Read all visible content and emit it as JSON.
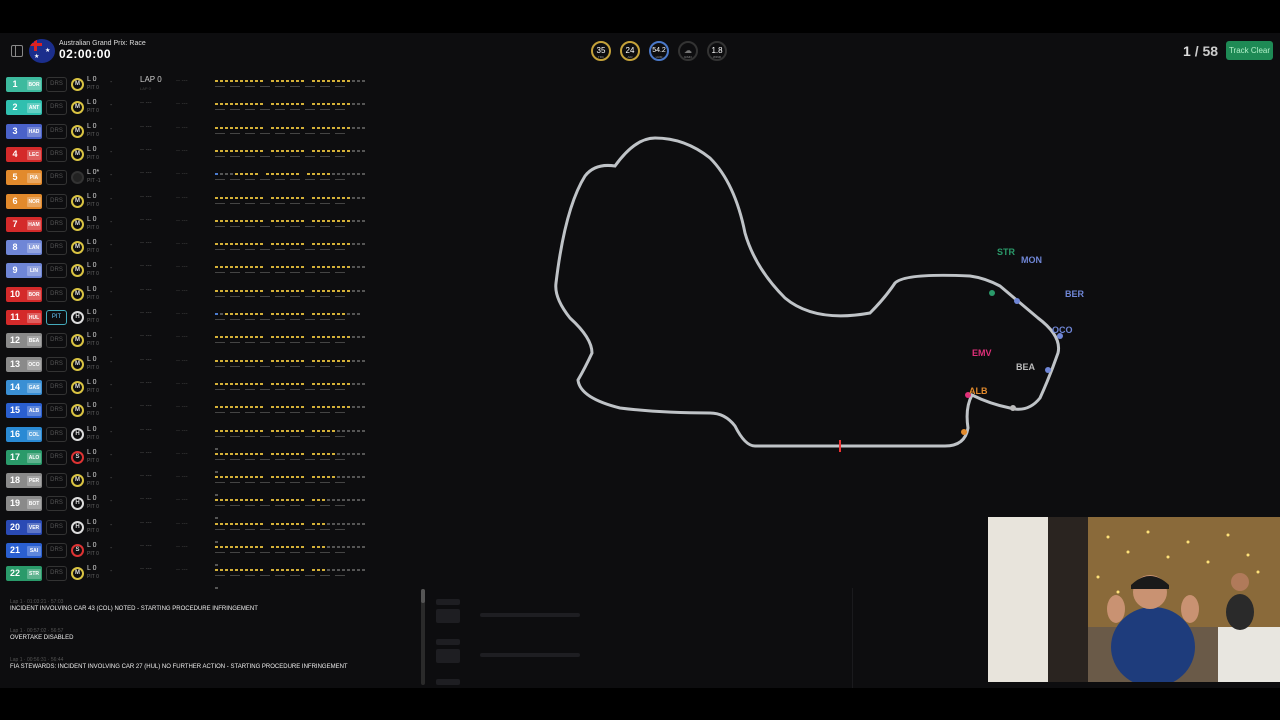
{
  "header": {
    "event_name": "Australian Grand Prix: Race",
    "session_time": "02:00:00",
    "weather": [
      {
        "value": "35",
        "label": "TRC"
      },
      {
        "value": "24",
        "label": "AIR"
      },
      {
        "value": "54.2",
        "label": "HUM"
      },
      {
        "value": "",
        "label": "RAIN"
      },
      {
        "value": "1.8",
        "label": "WIND"
      }
    ],
    "current_lap": "1",
    "total_laps": "/ 58",
    "track_status": "Track Clear"
  },
  "drivers": [
    {
      "pos": "1",
      "code": "BOR",
      "color": "#3dba9e",
      "drs": "DRS",
      "tyre": "M",
      "lap": "L 0",
      "pit": "PIT 0",
      "gap": "LAP 0",
      "gap_sub": "LAP 0"
    },
    {
      "pos": "2",
      "code": "ANT",
      "color": "#30bfaf",
      "drs": "DRS",
      "tyre": "M",
      "lap": "L 0",
      "pit": "PIT 0",
      "gap": "",
      "gap_sub": ""
    },
    {
      "pos": "3",
      "code": "HAD",
      "color": "#4a62c9",
      "drs": "DRS",
      "tyre": "M",
      "lap": "L 0",
      "pit": "PIT 0",
      "gap": "",
      "gap_sub": ""
    },
    {
      "pos": "4",
      "code": "LEC",
      "color": "#d42a2a",
      "drs": "DRS",
      "tyre": "M",
      "lap": "L 0",
      "pit": "PIT 0",
      "gap": "",
      "gap_sub": ""
    },
    {
      "pos": "5",
      "code": "PIA",
      "color": "#e28a2c",
      "drs": "DRS",
      "tyre": "",
      "lap": "L 0*",
      "pit": "PIT -1",
      "gap": "",
      "gap_sub": ""
    },
    {
      "pos": "6",
      "code": "NOR",
      "color": "#e28a2c",
      "drs": "DRS",
      "tyre": "M",
      "lap": "L 0",
      "pit": "PIT 0",
      "gap": "",
      "gap_sub": ""
    },
    {
      "pos": "7",
      "code": "HAM",
      "color": "#d42a2a",
      "drs": "DRS",
      "tyre": "M",
      "lap": "L 0",
      "pit": "PIT 0",
      "gap": "",
      "gap_sub": ""
    },
    {
      "pos": "8",
      "code": "LAN",
      "color": "#6f86d6",
      "drs": "DRS",
      "tyre": "M",
      "lap": "L 0",
      "pit": "PIT 0",
      "gap": "",
      "gap_sub": ""
    },
    {
      "pos": "9",
      "code": "LIN",
      "color": "#6f86d6",
      "drs": "DRS",
      "tyre": "M",
      "lap": "L 0",
      "pit": "PIT 0",
      "gap": "",
      "gap_sub": ""
    },
    {
      "pos": "10",
      "code": "BOR",
      "color": "#d42a2a",
      "drs": "DRS",
      "tyre": "M",
      "lap": "L 0",
      "pit": "PIT 0",
      "gap": "",
      "gap_sub": ""
    },
    {
      "pos": "11",
      "code": "HUL",
      "color": "#d42a2a",
      "drs": "PIT",
      "tyre": "H",
      "lap": "L 0",
      "pit": "PIT 0",
      "gap": "",
      "gap_sub": ""
    },
    {
      "pos": "12",
      "code": "BEA",
      "color": "#8a8a8a",
      "drs": "DRS",
      "tyre": "M",
      "lap": "L 0",
      "pit": "PIT 0",
      "gap": "",
      "gap_sub": ""
    },
    {
      "pos": "13",
      "code": "OCO",
      "color": "#8a8a8a",
      "drs": "DRS",
      "tyre": "M",
      "lap": "L 0",
      "pit": "PIT 0",
      "gap": "",
      "gap_sub": ""
    },
    {
      "pos": "14",
      "code": "GAS",
      "color": "#3a8fd4",
      "drs": "DRS",
      "tyre": "M",
      "lap": "L 0",
      "pit": "PIT 0",
      "gap": "",
      "gap_sub": ""
    },
    {
      "pos": "15",
      "code": "ALB",
      "color": "#2a5fd0",
      "drs": "DRS",
      "tyre": "M",
      "lap": "L 0",
      "pit": "PIT 0",
      "gap": "",
      "gap_sub": ""
    },
    {
      "pos": "16",
      "code": "COL",
      "color": "#2a8ad4",
      "drs": "DRS",
      "tyre": "H",
      "lap": "L 0",
      "pit": "PIT 0",
      "gap": "",
      "gap_sub": ""
    },
    {
      "pos": "17",
      "code": "ALO",
      "color": "#2a9a6a",
      "drs": "DRS",
      "tyre": "S",
      "lap": "L 0",
      "pit": "PIT 0",
      "gap": "",
      "gap_sub": ""
    },
    {
      "pos": "18",
      "code": "PER",
      "color": "#8a8a8a",
      "drs": "DRS",
      "tyre": "M",
      "lap": "L 0",
      "pit": "PIT 0",
      "gap": "",
      "gap_sub": ""
    },
    {
      "pos": "19",
      "code": "BOT",
      "color": "#8a8a8a",
      "drs": "DRS",
      "tyre": "H",
      "lap": "L 0",
      "pit": "PIT 0",
      "gap": "",
      "gap_sub": ""
    },
    {
      "pos": "20",
      "code": "VER",
      "color": "#2a4ab4",
      "drs": "DRS",
      "tyre": "H",
      "lap": "L 0",
      "pit": "PIT 0",
      "gap": "",
      "gap_sub": ""
    },
    {
      "pos": "21",
      "code": "SAI",
      "color": "#2a5fd0",
      "drs": "DRS",
      "tyre": "S",
      "lap": "L 0",
      "pit": "PIT 0",
      "gap": "",
      "gap_sub": ""
    },
    {
      "pos": "22",
      "code": "STR",
      "color": "#2a9a6a",
      "drs": "DRS",
      "tyre": "M",
      "lap": "L 0",
      "pit": "PIT 0",
      "gap": "",
      "gap_sub": ""
    }
  ],
  "track_map": {
    "driver_labels": [
      {
        "code": "STR",
        "color": "#2a9a6a"
      },
      {
        "code": "MON",
        "color": "#6f86d6"
      },
      {
        "code": "BER",
        "color": "#6f86d6"
      },
      {
        "code": "OCO",
        "color": "#6f86d6"
      },
      {
        "code": "BEA",
        "color": "#bbbbbb"
      },
      {
        "code": "EMV",
        "color": "#e0307a"
      },
      {
        "code": "ALB",
        "color": "#e28a2c"
      }
    ]
  },
  "race_control": [
    {
      "time": "Lap 1 · 01:03:21 · 57:03",
      "text": "INCIDENT INVOLVING CAR 43 (COL) NOTED - STARTING PROCEDURE INFRINGEMENT"
    },
    {
      "time": "Lap 1 · 00:57:02 · 56:57",
      "text": "OVERTAKE DISABLED"
    },
    {
      "time": "Lap 1 · 00:56:31 · 56:44",
      "text": "FIA STEWARDS: INCIDENT INVOLVING CAR 27 (HUL) NO FURTHER ACTION - STARTING PROCEDURE INFRINGEMENT"
    }
  ]
}
